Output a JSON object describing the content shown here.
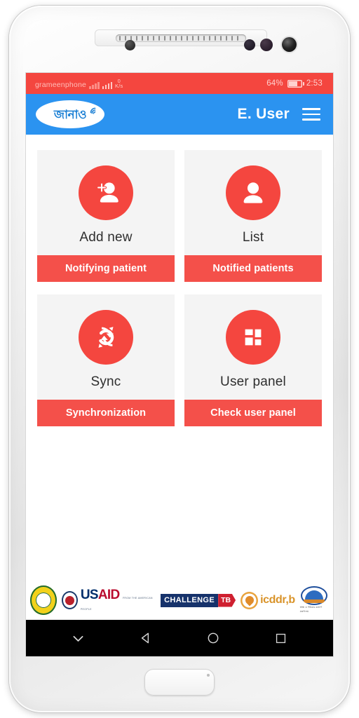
{
  "status_bar": {
    "carrier": "grameenphone",
    "data_rate_value": "0",
    "data_rate_unit": "K/s",
    "battery_percent": "64%",
    "time": "2:53",
    "background_color": "#f4463f"
  },
  "app_bar": {
    "logo_text": "জানাও",
    "logo_icon": "broadcast-wave-icon",
    "username": "E. User",
    "menu_icon": "hamburger-menu-icon",
    "background_color": "#2b93f0"
  },
  "cards": [
    {
      "title": "Add new",
      "footer": "Notifying patient",
      "icon": "add-person-icon"
    },
    {
      "title": "List",
      "footer": "Notified patients",
      "icon": "person-icon"
    },
    {
      "title": "Sync",
      "footer": "Synchronization",
      "icon": "sync-arrows-icon"
    },
    {
      "title": "User panel",
      "footer": "Check user panel",
      "icon": "dashboard-grid-icon"
    }
  ],
  "theme": {
    "accent_red": "#f4463f",
    "footer_red": "#f4504a",
    "header_blue": "#2b93f0",
    "card_background": "#f4f4f4"
  },
  "partners": [
    {
      "name": "national-tb-programme-seal",
      "label": ""
    },
    {
      "name": "usaid-logo",
      "word1": "US",
      "word2": "AID",
      "tagline": "FROM THE AMERICAN PEOPLE"
    },
    {
      "name": "challenge-tb-logo",
      "word1": "CHALLENGE",
      "word2": "TB"
    },
    {
      "name": "icddrb-logo",
      "label": "icddr,b"
    },
    {
      "name": "government-emblem",
      "caption": "স্বাস্থ্য ও পরিবার কল্যাণ মন্ত্রণালয়"
    }
  ],
  "nav_bar": {
    "buttons": [
      {
        "icon": "chevron-down-icon",
        "label": "Hide navigation"
      },
      {
        "icon": "back-triangle-icon",
        "label": "Back"
      },
      {
        "icon": "home-circle-icon",
        "label": "Home"
      },
      {
        "icon": "recents-square-icon",
        "label": "Recent apps"
      }
    ]
  }
}
